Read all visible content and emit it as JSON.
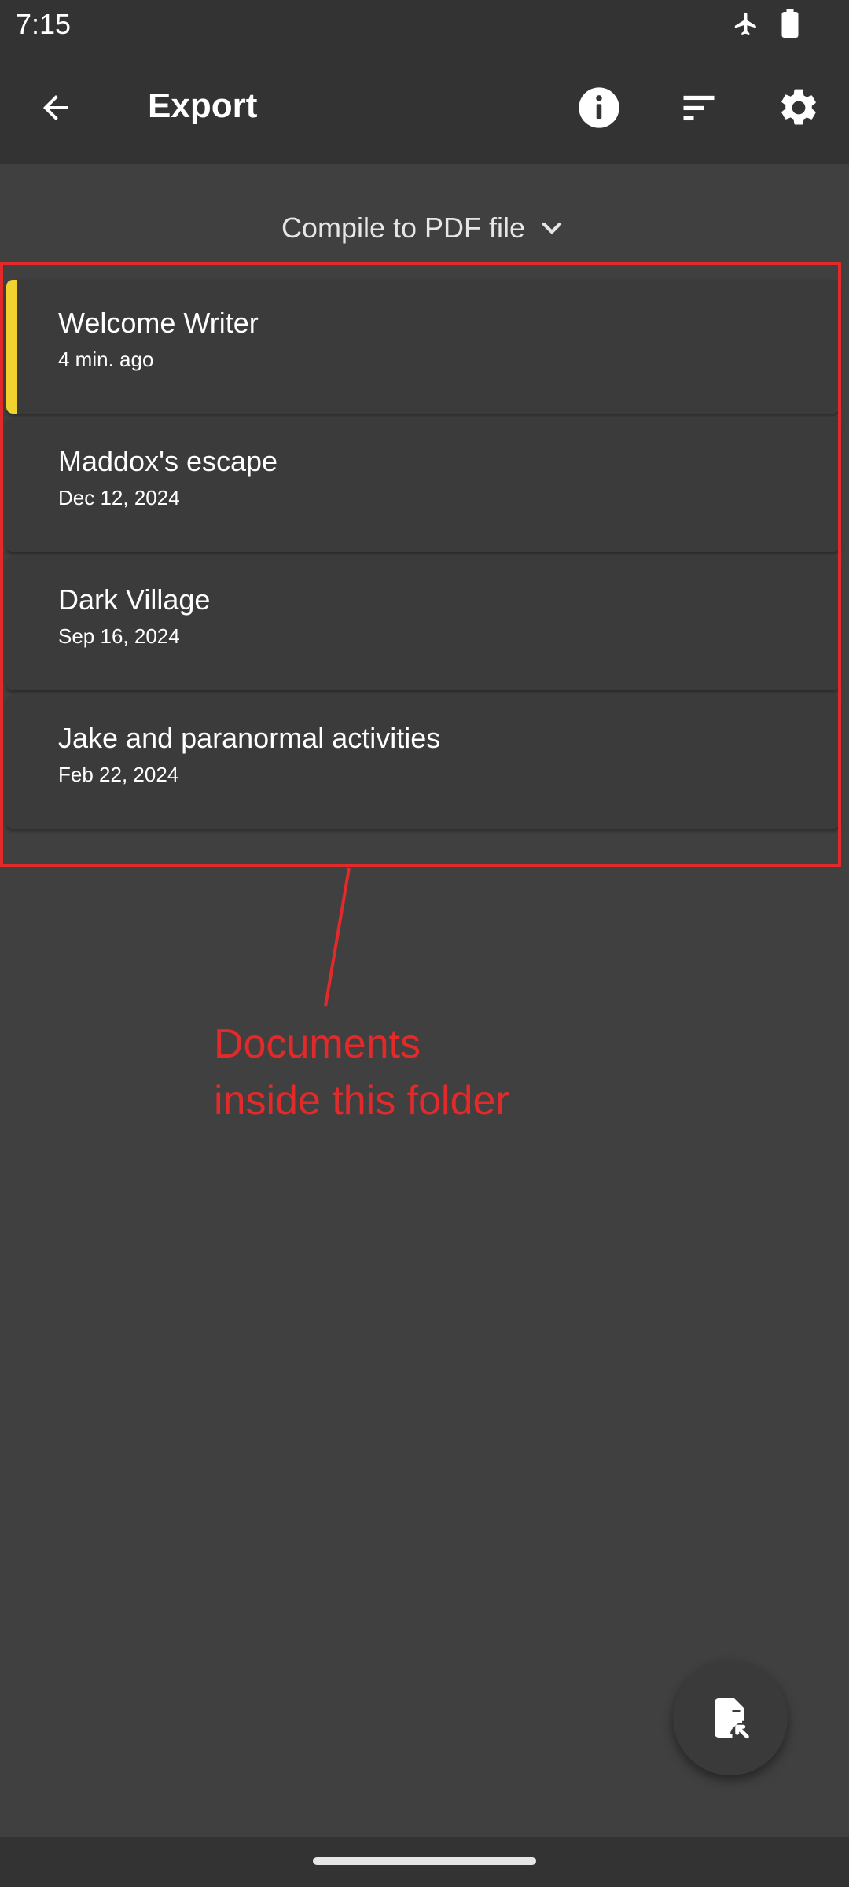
{
  "status_bar": {
    "time": "7:15",
    "icons": [
      "airplane-icon",
      "battery-icon"
    ]
  },
  "app_bar": {
    "title": "Export",
    "back_icon": "arrow-back-icon",
    "actions": [
      "info-icon",
      "sort-icon",
      "gear-icon"
    ]
  },
  "compile": {
    "label": "Compile to PDF file",
    "icon": "chevron-down-icon"
  },
  "documents": [
    {
      "title": "Welcome Writer",
      "date": "4 min. ago",
      "selected": true
    },
    {
      "title": "Maddox's escape",
      "date": "Dec 12, 2024",
      "selected": false
    },
    {
      "title": "Dark Village",
      "date": "Sep 16, 2024",
      "selected": false
    },
    {
      "title": "Jake and paranormal activities",
      "date": "Feb 22, 2024",
      "selected": false
    }
  ],
  "annotation": {
    "line1": "Documents",
    "line2": "inside this folder",
    "color": "#e32a2a"
  },
  "fab": {
    "icon": "file-export-icon"
  },
  "colors": {
    "background": "#404040",
    "bar": "#333333",
    "card": "#3b3b3b",
    "accent": "#f2d22e",
    "annotation": "#e32a2a"
  }
}
